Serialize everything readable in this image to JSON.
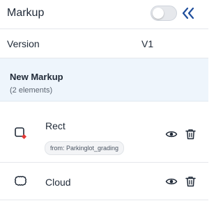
{
  "panel": {
    "title": "Markup",
    "toggle_on": false,
    "collapse_icon": "double-chevron-left-icon",
    "accent_color": "#1f4e9c"
  },
  "version": {
    "label": "Version",
    "value": "V1"
  },
  "group": {
    "name": "New Markup",
    "count_label": "(2 elements)"
  },
  "elements": [
    {
      "name": "Rect",
      "icon": "rectangle-shape-icon",
      "source_prefix": "from: ",
      "source": "Parkinglot_grading",
      "marker_color": "#e53935"
    },
    {
      "name": "Cloud",
      "icon": "cloud-shape-icon"
    }
  ],
  "actions": {
    "visibility_icon": "eye-icon",
    "delete_icon": "trash-icon"
  }
}
